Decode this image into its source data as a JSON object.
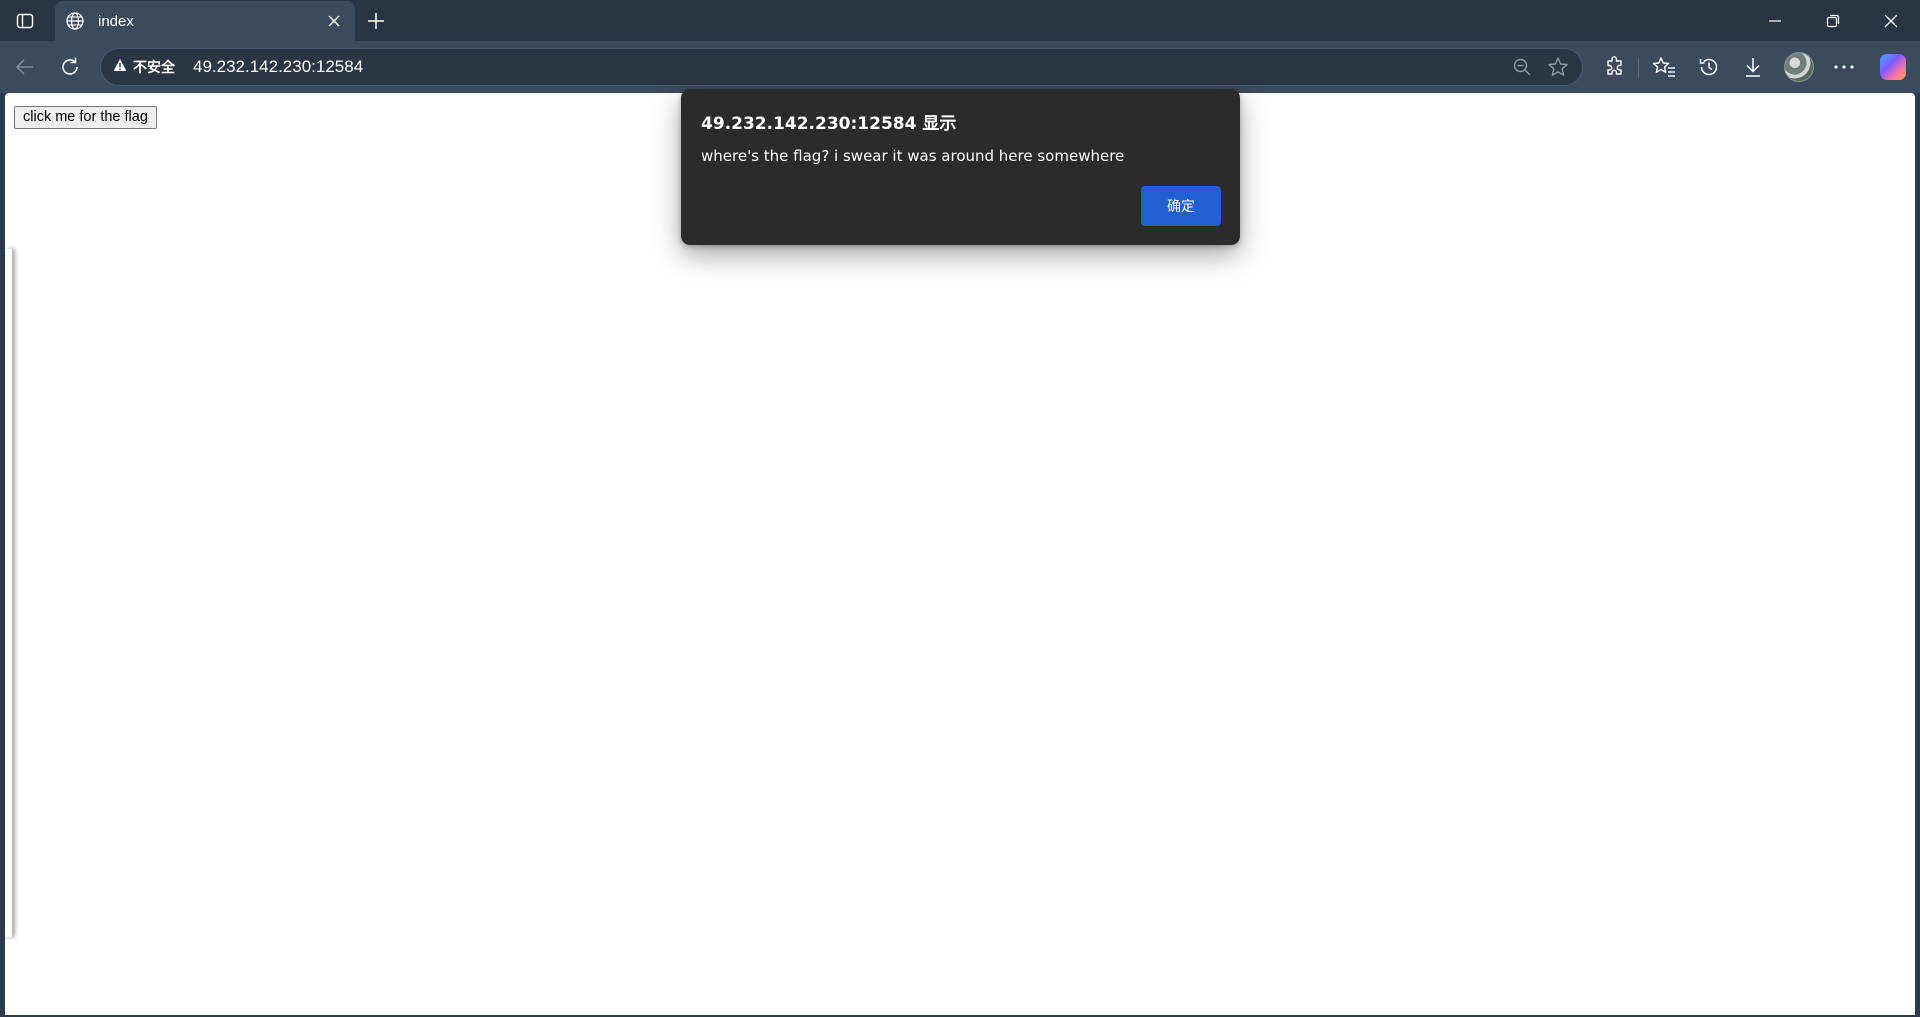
{
  "browser": {
    "tab": {
      "title": "index"
    },
    "address_bar": {
      "security_label": "不安全",
      "url": "49.232.142.230:12584"
    }
  },
  "icons": {
    "tab_actions": "tab-actions-icon",
    "favicon": "globe-icon",
    "tab_close": "close-icon",
    "new_tab": "plus-icon",
    "minimize": "minimize-icon",
    "restore": "restore-icon",
    "window_close": "close-icon",
    "back": "arrow-left-icon",
    "refresh": "refresh-icon",
    "warning": "warning-icon",
    "zoom": "zoom-out-icon",
    "favorite": "star-icon",
    "extensions": "puzzle-icon",
    "favorites": "favorites-icon",
    "history": "history-icon",
    "downloads": "download-icon",
    "more": "more-icon",
    "copilot": "copilot-icon"
  },
  "page": {
    "button_label": "click me for the flag"
  },
  "dialog": {
    "title": "49.232.142.230:12584 显示",
    "message": "where's the flag? i swear it was around here somewhere",
    "ok_label": "确定"
  },
  "colors": {
    "frame": "#293445",
    "toolbar": "#3b4a5e",
    "dialog_bg": "#2b2b2b",
    "dialog_button": "#2160d0"
  }
}
